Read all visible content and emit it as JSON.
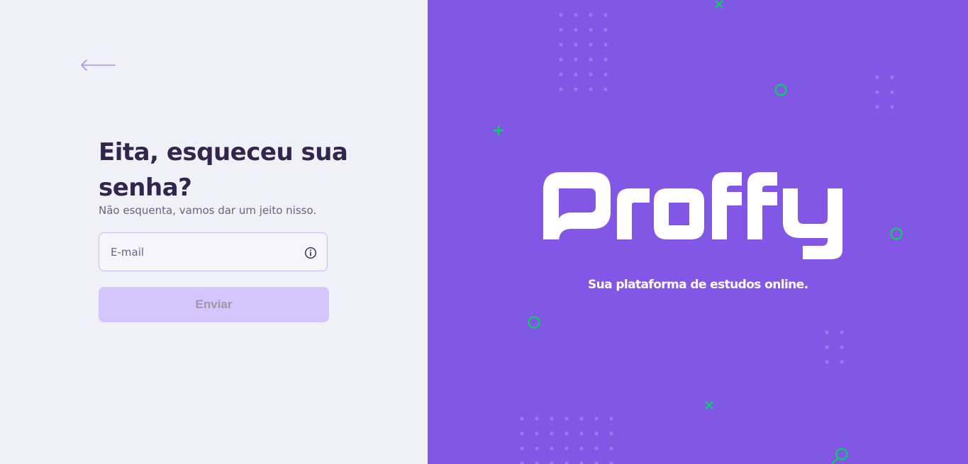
{
  "form": {
    "back_icon": "arrow-left-icon",
    "title": "Eita, esqueceu sua senha?",
    "subtitle": "Não esquenta, vamos dar um jeito nisso.",
    "email_placeholder": "E-mail",
    "email_value": "",
    "info_icon": "info-circle-icon",
    "submit_label": "Enviar"
  },
  "brand": {
    "logo_text": "Proffy",
    "slogan": "Sua plataforma de estudos online."
  },
  "colors": {
    "primary": "#8257e5",
    "background": "#f0f0f7",
    "title": "#32264d",
    "text": "#6a6180",
    "input_border": "#c8b9f7",
    "button_disabled": "#d6c5fd",
    "button_text_disabled": "#9c98a6",
    "accent_green": "#04d361"
  }
}
